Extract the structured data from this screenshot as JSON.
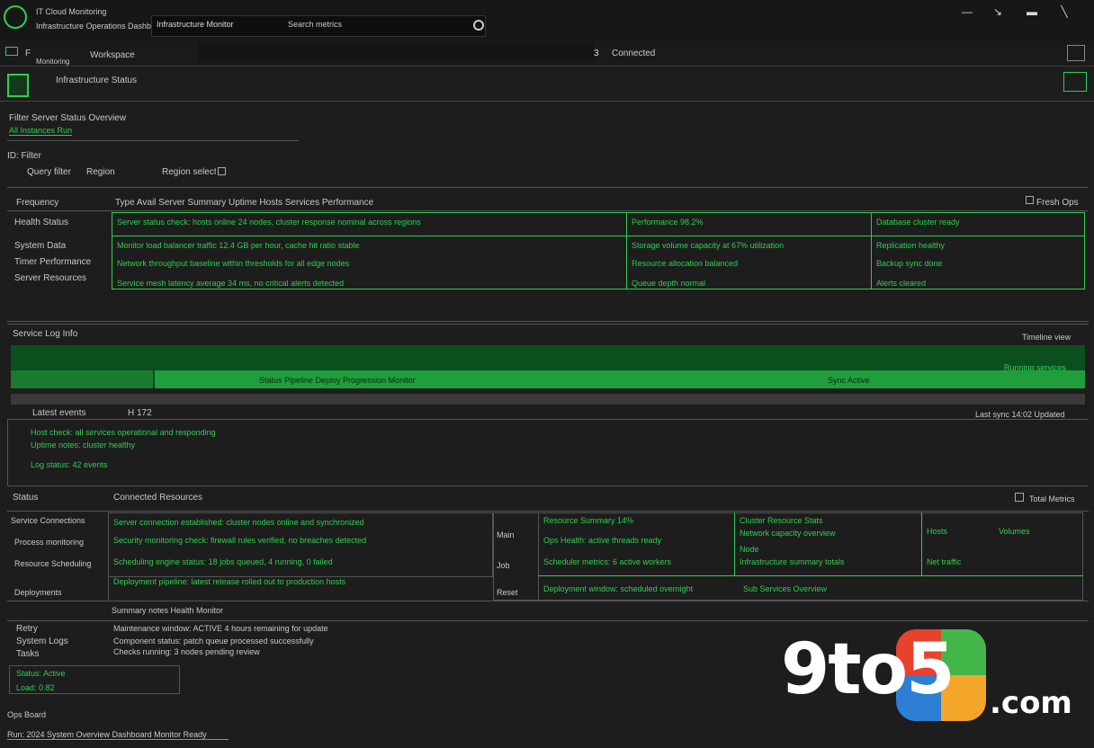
{
  "window": {
    "title": "IT Cloud Monitoring",
    "subtitle": "Infrastructure Operations Dashboard",
    "tab_title": "Infrastructure Monitor",
    "search_label": "Search metrics"
  },
  "toolbar": {
    "section_label": "Monitoring tools",
    "view_label": "Workspace",
    "count": "3",
    "status_label": "Connected"
  },
  "header": {
    "page_label": "Infrastructure Status",
    "filter_line": "Filter Server Status Overview",
    "filter_sub": "All Instances Running",
    "id_label": "ID: Filter",
    "query_label": "Query filter",
    "region_label": "Region",
    "selector_label": "Region select"
  },
  "overview": {
    "title": "Frequency",
    "columns": "Type   Avail   Server Summary Uptime Hosts  Services   Performance",
    "right_label": "Fresh Ops",
    "left_rows": [
      "Health Status",
      "System Data",
      "Timer Performance",
      "Server Resources"
    ],
    "rows": [
      [
        "Server status check: hosts online 24 nodes, cluster response nominal across regions",
        "Performance 98.2%",
        "Database cluster ready"
      ],
      [
        "Monitor load balancer traffic 12.4 GB per hour, cache hit ratio stable",
        "Storage volume capacity at 67% utilization",
        "Replication healthy"
      ],
      [
        "Network throughput baseline within thresholds for all edge nodes",
        "Resource allocation balanced",
        "Backup sync done"
      ],
      [
        "Service mesh latency average 34 ms, no critical alerts detected",
        "Queue depth normal",
        "Alerts cleared"
      ]
    ]
  },
  "timeline": {
    "title": "Service Log Info",
    "right_top": "Timeline view",
    "right_mid": "Running services",
    "bar_label": "Status   Pipeline   Deploy Progression Monitor",
    "bar_right": "Sync Active",
    "footer_left": "Latest events",
    "footer_mid": "H 172",
    "footer_right": "Last sync 14:02   Updated",
    "events": [
      "Host check: all services operational and responding",
      "Uptime notes: cluster healthy",
      "Log status: 42 events"
    ]
  },
  "details": {
    "title": "Status",
    "heading": "Connected Resources",
    "right_label": "Total Metrics",
    "left_rows": [
      "Service Connections",
      "Process monitoring",
      "Resource Scheduling",
      "Deployments"
    ],
    "lines": [
      "Server connection established: cluster nodes online and synchronized",
      "Security monitoring check: firewall rules verified, no breaches detected",
      "Scheduling engine status: 18 jobs queued, 4 running, 0 failed",
      "Deployment pipeline: latest release rolled out to production hosts"
    ],
    "mid_labels": [
      "Main",
      "Job",
      "Reset"
    ],
    "mid_rows": [
      "Resource Summary 14%",
      "Ops Health: active threads ready",
      "Scheduler metrics: 6 active workers",
      "Deployment window: scheduled overnight"
    ],
    "right_rows": [
      "Cluster Resource Stats",
      "Network capacity overview",
      "Node",
      "Infrastructure summary totals"
    ],
    "far_right": [
      "Hosts",
      "Volumes",
      "Net traffic"
    ],
    "footer": "Sub Services Overview"
  },
  "bottom": {
    "label1": "Retry",
    "label2": "System Logs",
    "label3": "Tasks",
    "lines": [
      "Maintenance window: ACTIVE 4 hours remaining for update",
      "Component status: patch queue processed successfully",
      "Checks running: 3 nodes pending review"
    ],
    "summary": "Summary notes   Health   Monitor",
    "status_lines": [
      "Status: Active",
      "Load: 0.82"
    ],
    "bottom_rows": [
      "Ops Board",
      "Run: 2024   System Overview   Dashboard Monitor   Ready"
    ]
  },
  "watermark": {
    "brand": "9to5",
    "suffix": ".com"
  },
  "colors": {
    "accent": "#2fcf4f",
    "background": "#1d1d1d",
    "bar": "#1f9e3b"
  }
}
